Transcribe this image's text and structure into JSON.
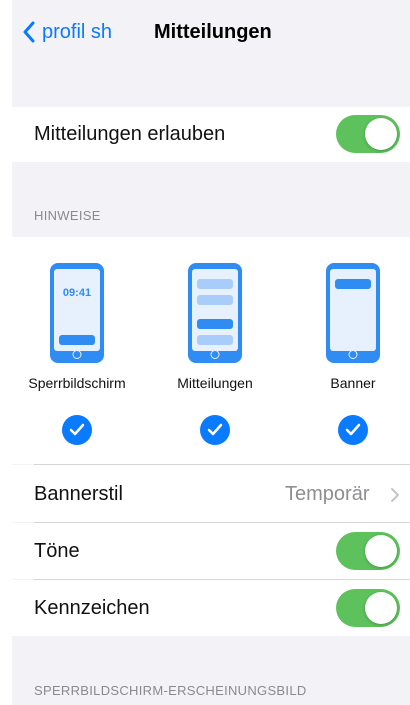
{
  "nav": {
    "back_label": "profil sh",
    "title": "Mitteilungen"
  },
  "allow": {
    "label": "Mitteilungen erlauben",
    "on": true
  },
  "hints": {
    "header": "HINWEISE",
    "styles": [
      {
        "label": "Sperrbildschirm",
        "clock": "09:41",
        "checked": true
      },
      {
        "label": "Mitteilungen",
        "checked": true
      },
      {
        "label": "Banner",
        "checked": true
      }
    ]
  },
  "settings": [
    {
      "label": "Bannerstil",
      "value": "Temporär"
    },
    {
      "label": "Töne",
      "on": true
    },
    {
      "label": "Kennzeichen",
      "on": true
    }
  ],
  "lockscreen_header": "SPERRBILDSCHIRM-ERSCHEINUNGSBILD",
  "colors": {
    "accent": "#0a7aff",
    "toggle_on": "#5ec25c",
    "phone_blue": "#2f8cf3",
    "background": "#f2f2f7"
  }
}
